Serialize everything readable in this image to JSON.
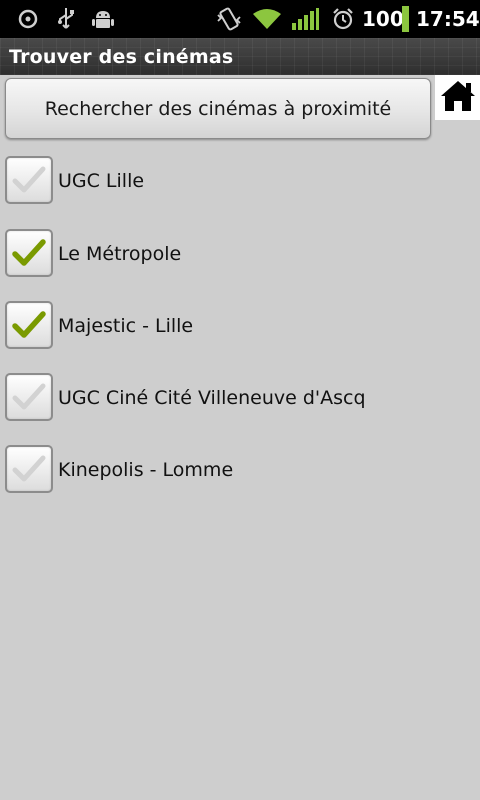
{
  "status_bar": {
    "battery_text": "100",
    "time": "17:54",
    "icons": [
      "sync-icon",
      "usb-icon",
      "android-debug-icon",
      "vibrate-icon",
      "wifi-icon",
      "signal-icon",
      "alarm-icon",
      "battery-icon"
    ]
  },
  "title_bar": {
    "title": "Trouver des cinémas"
  },
  "search": {
    "button_label": "Rechercher des cinémas à proximité"
  },
  "home": {
    "icon": "home-icon"
  },
  "cinemas": [
    {
      "name": "UGC Lille",
      "checked": false
    },
    {
      "name": "Le Métropole",
      "checked": true
    },
    {
      "name": "Majestic - Lille",
      "checked": true
    },
    {
      "name": "UGC Ciné Cité Villeneuve d'Ascq",
      "checked": false
    },
    {
      "name": "Kinepolis - Lomme",
      "checked": false
    }
  ],
  "colors": {
    "check_on": "#7a9a00",
    "check_off": "#d0d0d0",
    "background": "#cecece",
    "signal_green": "#8cc63f"
  }
}
